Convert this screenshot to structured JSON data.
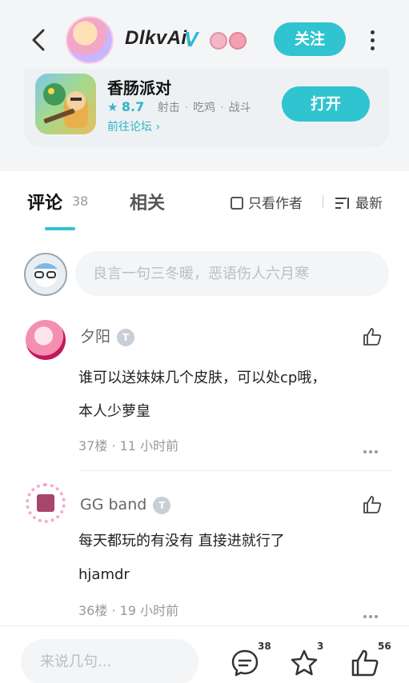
{
  "header": {
    "user_name": "DlkvAi.",
    "verified_mark": "V",
    "follow_label": "关注"
  },
  "game": {
    "title": "香肠派对",
    "rating": "8.7",
    "tags": [
      "射击",
      "吃鸡",
      "战斗"
    ],
    "forum_link": "前往论坛 ›",
    "open_label": "打开"
  },
  "tabs": {
    "comments_label": "评论",
    "comments_count": "38",
    "related_label": "相关",
    "author_only_label": "只看作者",
    "sort_label": "最新"
  },
  "compose": {
    "placeholder": "良言一句三冬暖，恶语伤人六月寒"
  },
  "comments": [
    {
      "name": "夕阳",
      "level": "T",
      "lines": [
        "谁可以送妹妹几个皮肤，可以处cp哦，",
        "本人少萝皇"
      ],
      "meta": "37楼 · 11 小时前"
    },
    {
      "name": "GG band",
      "level": "T",
      "lines": [
        "每天都玩的有没有 直接进就行了",
        " hjamdr"
      ],
      "meta": "36楼 · 19 小时前"
    }
  ],
  "bottom_bar": {
    "input_placeholder": "来说几句...",
    "comment_count": "38",
    "favorite_count": "3",
    "like_count": "56"
  },
  "colors": {
    "accent": "#2fc4cf"
  },
  "icons": [
    "back-icon",
    "more-icon",
    "star-icon",
    "checkbox-icon",
    "sort-icon",
    "like-icon",
    "comment-bubble-icon",
    "favorite-star-icon",
    "thumb-up-icon"
  ]
}
